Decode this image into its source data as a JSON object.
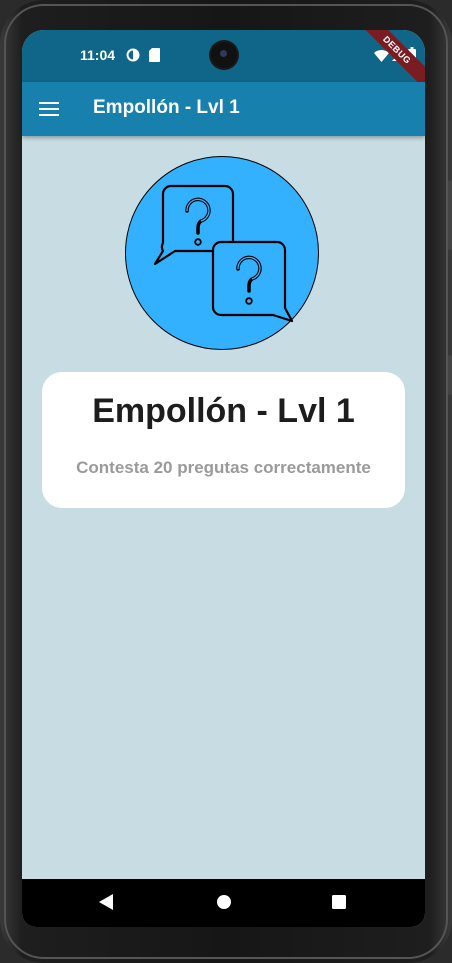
{
  "status_bar": {
    "time": "11:04",
    "debug_banner": "DEBUG",
    "icons": [
      "data-saver-icon",
      "sim-card-icon",
      "wifi-icon",
      "signal-icon",
      "battery-icon"
    ]
  },
  "app_bar": {
    "title": "Empollón - Lvl 1",
    "menu_icon": "menu-icon",
    "color": "#1780ad"
  },
  "hero": {
    "icon": "question-chat-bubbles-icon",
    "background": "#33b1ff"
  },
  "card": {
    "title": "Empollón - Lvl 1",
    "subtitle": "Contesta 20 pregutas correctamente"
  },
  "nav_bar": {
    "buttons": [
      "back-icon",
      "home-icon",
      "recents-icon"
    ]
  },
  "colors": {
    "page_background": "#c8dde3",
    "status_bar": "#0f6688"
  }
}
